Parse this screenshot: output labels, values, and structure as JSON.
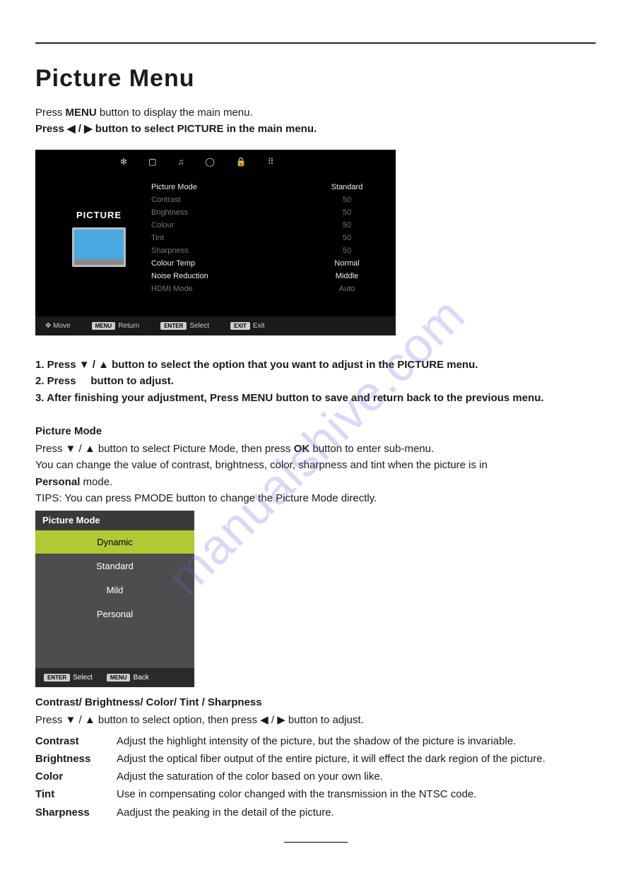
{
  "watermark": "manualshive.com",
  "title": "Picture Menu",
  "intro": {
    "line1_a": "Press ",
    "line1_b": "MENU",
    "line1_c": " button to display the main menu.",
    "line2_a": "Press ◀ / ▶ button to select ",
    "line2_b": "PICTURE",
    "line2_c": " in the main menu."
  },
  "osd": {
    "icons": [
      "✻",
      "▢",
      "♫",
      "◯",
      "🔒",
      "⠿"
    ],
    "left_title": "PICTURE",
    "items": [
      {
        "label": "Picture Mode",
        "value": "Standard",
        "dim": false
      },
      {
        "label": "Contrast",
        "value": "50",
        "dim": true
      },
      {
        "label": "Brightness",
        "value": "50",
        "dim": true
      },
      {
        "label": "Colour",
        "value": "50",
        "dim": true
      },
      {
        "label": "Tint",
        "value": "50",
        "dim": true
      },
      {
        "label": "Sharpness",
        "value": "50",
        "dim": true
      },
      {
        "label": "Colour Temp",
        "value": "Normal",
        "dim": false
      },
      {
        "label": "Noise Reduction",
        "value": "Middle",
        "dim": false
      },
      {
        "label": "HDMI Mode",
        "value": "Auto",
        "dim": true
      }
    ],
    "footer": [
      {
        "key": "",
        "text": "✥ Move"
      },
      {
        "key": "MENU",
        "text": "Return"
      },
      {
        "key": "ENTER",
        "text": "Select"
      },
      {
        "key": "EXIT",
        "text": "Exit"
      }
    ]
  },
  "steps": {
    "s1_a": "1. Press ▼ / ▲ button to select the option that you want to adjust in the ",
    "s1_b": "PICTURE",
    "s1_c": " menu.",
    "s2_a": "2. Press",
    "s2_b": "button to adjust.",
    "s3_a": "3. After finishing your adjustment, Press ",
    "s3_b": "MENU",
    "s3_c": " button to save and return back to the previous menu."
  },
  "picture_mode": {
    "heading": "Picture Mode",
    "line1_a": "Press ▼ / ▲ button to select Picture Mode,  then press ",
    "line1_b": "OK",
    "line1_c": " button to enter sub-menu.",
    "line2": "You can change the value of  contrast, brightness, color, sharpness and tint when the picture is in",
    "line3_a": "Personal",
    "line3_b": " mode.",
    "tips": "TIPS: You can press PMODE button  to change the Picture Mode directly."
  },
  "submenu": {
    "header": "Picture Mode",
    "options": [
      {
        "label": "Dynamic",
        "selected": true
      },
      {
        "label": "Standard",
        "selected": false
      },
      {
        "label": "Mild",
        "selected": false
      },
      {
        "label": "Personal",
        "selected": false
      }
    ],
    "footer": [
      {
        "key": "ENTER",
        "text": "Select"
      },
      {
        "key": "MENU",
        "text": "Back"
      }
    ]
  },
  "cbcts": {
    "heading": "Contrast/ Brightness/ Color/ Tint / Sharpness",
    "intro": "Press ▼ / ▲ button to select option,  then press   ◀ / ▶ button to adjust.",
    "defs": [
      {
        "term": "Contrast",
        "def": "Adjust the highlight intensity of the picture, but the shadow of the picture is invariable."
      },
      {
        "term": "Brightness",
        "def": "Adjust the optical fiber output of the entire picture, it will effect the dark region of the picture."
      },
      {
        "term": "Color",
        "def": "Adjust the saturation of the color based on your own like."
      },
      {
        "term": "Tint",
        "def": "Use in compensating color changed with the transmission in the NTSC code."
      },
      {
        "term": "Sharpness",
        "def": "Aadjust the peaking in the detail of the picture."
      }
    ]
  }
}
